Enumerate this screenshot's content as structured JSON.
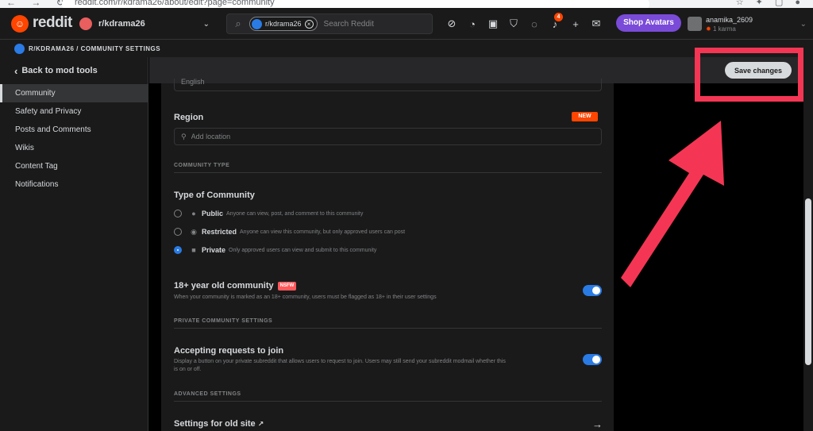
{
  "browser": {
    "url": "reddit.com/r/kdrama26/about/edit?page=community"
  },
  "header": {
    "logo_text": "reddit",
    "subreddit": "r/kdrama26",
    "search": {
      "chip_label": "r/kdrama26",
      "placeholder": "Search Reddit"
    },
    "notification_count": "4",
    "shop_label": "Shop Avatars",
    "user": {
      "name": "anamika_2609",
      "karma": "1 karma"
    }
  },
  "breadcrumb": {
    "text": "R/KDRAMA26 / COMMUNITY SETTINGS"
  },
  "sidebar": {
    "back_label": "Back to mod tools",
    "items": [
      {
        "label": "Community"
      },
      {
        "label": "Safety and Privacy"
      },
      {
        "label": "Posts and Comments"
      },
      {
        "label": "Wikis"
      },
      {
        "label": "Content Tag"
      },
      {
        "label": "Notifications"
      }
    ]
  },
  "actions": {
    "save_label": "Save changes"
  },
  "settings": {
    "language_value": "English",
    "region_label": "Region",
    "new_badge": "NEW",
    "location_placeholder": "Add location",
    "community_type_heading": "COMMUNITY TYPE",
    "type_of_community_label": "Type of Community",
    "types": [
      {
        "title": "Public",
        "desc": "Anyone can view, post, and comment to this community",
        "checked": false
      },
      {
        "title": "Restricted",
        "desc": "Anyone can view this community, but only approved users can post",
        "checked": false
      },
      {
        "title": "Private",
        "desc": "Only approved users can view and submit to this community",
        "checked": true
      }
    ],
    "adult": {
      "title": "18+ year old community",
      "badge": "NSFW",
      "desc": "When your community is marked as an 18+ community, users must be flagged as 18+ in their user settings",
      "enabled": true
    },
    "private_settings_heading": "PRIVATE COMMUNITY SETTINGS",
    "requests": {
      "title": "Accepting requests to join",
      "desc": "Display a button on your private subreddit that allows users to request to join. Users may still send your subreddit modmail whether this is on or off.",
      "enabled": true
    },
    "advanced_heading": "ADVANCED SETTINGS",
    "old_site_label": "Settings for old site"
  },
  "colors": {
    "accent": "#2a7be4",
    "reddit_orange": "#ff4500",
    "annotation_red": "#f43654"
  }
}
